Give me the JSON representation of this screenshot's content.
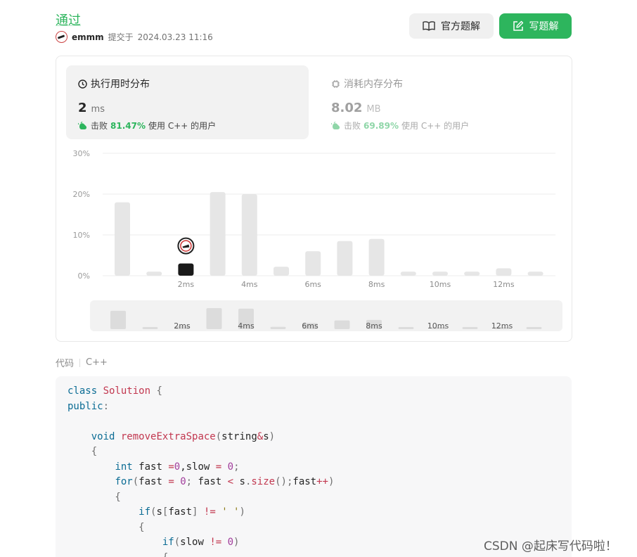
{
  "header": {
    "status": "通过",
    "username": "emmm",
    "submitted_prefix": "提交于",
    "submitted_time": "2024.03.23 11:16"
  },
  "buttons": {
    "official": "官方题解",
    "write": "写题解"
  },
  "stats": {
    "runtime": {
      "title": "执行用时分布",
      "value": "2",
      "unit": "ms",
      "beat_prefix": "击败",
      "beat_pct": "81.47%",
      "beat_suffix": "使用 C++ 的用户"
    },
    "memory": {
      "title": "消耗内存分布",
      "value": "8.02",
      "unit": "MB",
      "beat_prefix": "击败",
      "beat_pct": "69.89%",
      "beat_suffix": "使用 C++ 的用户"
    }
  },
  "chart_data": {
    "type": "bar",
    "y_ticks": [
      "30%",
      "20%",
      "10%",
      "0%"
    ],
    "ylim": [
      0,
      30
    ],
    "x_tick_labels": [
      "2ms",
      "4ms",
      "6ms",
      "8ms",
      "10ms",
      "12ms"
    ],
    "values": [
      18,
      1,
      3,
      20.5,
      20,
      2.2,
      6,
      8.5,
      9,
      1,
      1,
      1,
      1.8,
      1
    ],
    "highlight_index": 2,
    "grid": true,
    "colors": {
      "bar": "#e6e6e6",
      "highlight": "#1a1a1a",
      "grid": "#eeeeee",
      "navigator_bg": "#f2f2f2",
      "navigator_bar": "#dcdcdc"
    }
  },
  "code_section": {
    "label": "代码",
    "language": "C++"
  },
  "code_lines": [
    [
      [
        "kw",
        "class "
      ],
      [
        "fn",
        "Solution"
      ],
      [
        "punc",
        " {"
      ]
    ],
    [
      [
        "kw",
        "public"
      ],
      [
        "punc",
        ":"
      ]
    ],
    [],
    [
      [
        "",
        "    "
      ],
      [
        "kw",
        "void "
      ],
      [
        "fn",
        "removeExtraSpace"
      ],
      [
        "punc",
        "("
      ],
      [
        "",
        "string"
      ],
      [
        "fn",
        "&"
      ],
      [
        "",
        "s"
      ],
      [
        "punc",
        ")"
      ]
    ],
    [
      [
        "punc",
        "    {"
      ]
    ],
    [
      [
        "",
        "        "
      ],
      [
        "kw",
        "int "
      ],
      [
        "",
        "fast "
      ],
      [
        "fn",
        "="
      ],
      [
        "num",
        "0"
      ],
      [
        "",
        ",slow "
      ],
      [
        "fn",
        "= "
      ],
      [
        "num",
        "0"
      ],
      [
        "punc",
        ";"
      ]
    ],
    [
      [
        "",
        "        "
      ],
      [
        "kw",
        "for"
      ],
      [
        "punc",
        "("
      ],
      [
        "",
        "fast "
      ],
      [
        "fn",
        "= "
      ],
      [
        "num",
        "0"
      ],
      [
        "punc",
        "; "
      ],
      [
        "",
        "fast "
      ],
      [
        "fn",
        "< "
      ],
      [
        "",
        "s"
      ],
      [
        "punc",
        "."
      ],
      [
        "fn",
        "size"
      ],
      [
        "punc",
        "();"
      ],
      [
        "",
        "fast"
      ],
      [
        "fn",
        "++"
      ],
      [
        "punc",
        ")"
      ]
    ],
    [
      [
        "punc",
        "        {"
      ]
    ],
    [
      [
        "",
        "            "
      ],
      [
        "kw",
        "if"
      ],
      [
        "punc",
        "("
      ],
      [
        "",
        "s"
      ],
      [
        "punc",
        "["
      ],
      [
        "",
        "fast"
      ],
      [
        "punc",
        "] "
      ],
      [
        "fn",
        "!= "
      ],
      [
        "str",
        "' '"
      ],
      [
        "punc",
        ")"
      ]
    ],
    [
      [
        "punc",
        "            {"
      ]
    ],
    [
      [
        "",
        "                "
      ],
      [
        "kw",
        "if"
      ],
      [
        "punc",
        "("
      ],
      [
        "",
        "slow "
      ],
      [
        "fn",
        "!= "
      ],
      [
        "num",
        "0"
      ],
      [
        "punc",
        ")"
      ]
    ],
    [
      [
        "punc",
        "                {"
      ]
    ]
  ],
  "watermark": "CSDN @起床写代码啦！"
}
